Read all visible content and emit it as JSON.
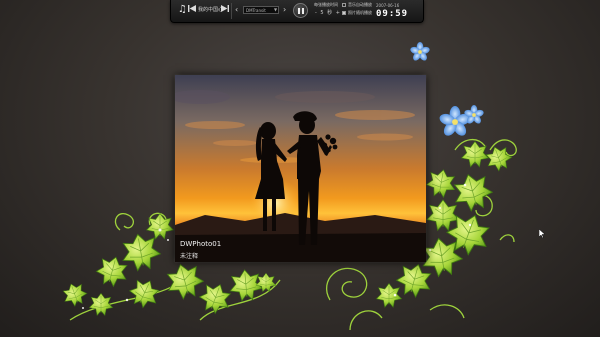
{
  "toolbar": {
    "music_icon": "music-note-icon",
    "music_title": "我的中国心",
    "effect_select": "DMTransit",
    "interval_label": "每张播放时间",
    "interval_stepper": "- 5 秒 +",
    "option1_label": "音乐自动播放",
    "option2_label": "照片随机播放"
  },
  "clock": {
    "date": "2007-06-16",
    "time": "09:59"
  },
  "photo": {
    "name": "DWPhoto01",
    "note": "未注释"
  },
  "colors": {
    "background": "#38332f",
    "leaf_light": "#b8e04a",
    "leaf_dark": "#5a9a1c",
    "flower_blue": "#5aa3e8",
    "sunset_orange": "#f08a1a"
  }
}
